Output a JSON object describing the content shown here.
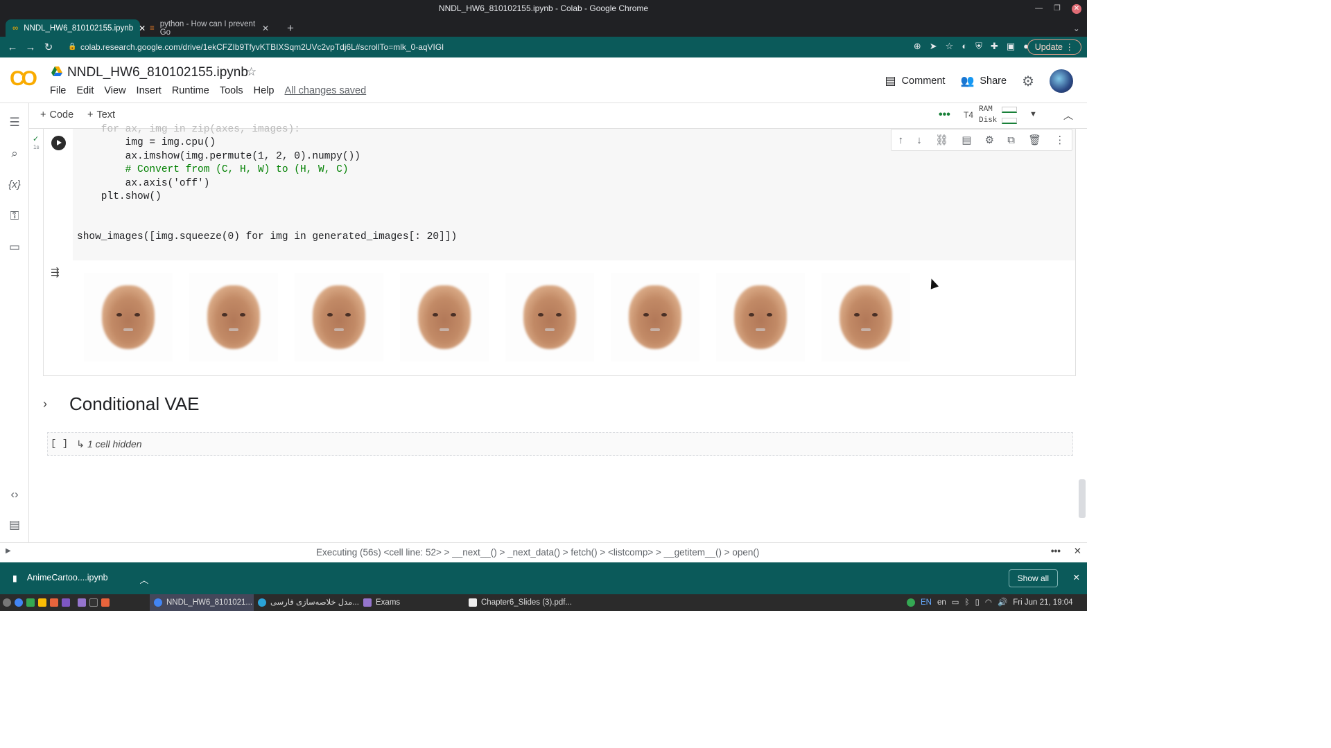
{
  "window": {
    "title": "NNDL_HW6_810102155.ipynb - Colab - Google Chrome"
  },
  "tabs": [
    {
      "label": "NNDL_HW6_810102155.ipynb"
    },
    {
      "label": "python - How can I prevent Go"
    }
  ],
  "address": {
    "url": "colab.research.google.com/drive/1ekCFZIb9TfyvKTBIXSqm2UVc2vpTdj6L#scrollTo=mlk_0-aqVIGl",
    "update_label": "Update"
  },
  "notebook": {
    "title": "NNDL_HW6_810102155.ipynb",
    "menu": [
      "File",
      "Edit",
      "View",
      "Insert",
      "Runtime",
      "Tools",
      "Help"
    ],
    "saved_status": "All changes saved",
    "comment_label": "Comment",
    "share_label": "Share"
  },
  "toolbar": {
    "code_label": "Code",
    "text_label": "Text",
    "runtime": "T4",
    "ram_label": "RAM",
    "disk_label": "Disk"
  },
  "cell": {
    "exec_time": "1s",
    "code_lines": [
      "    for ax, img in zip(axes, images):",
      "        img = img.cpu()",
      "        ax.imshow(img.permute(1, 2, 0).numpy())",
      "        # Convert from (C, H, W) to (H, W, C)",
      "        ax.axis('off')",
      "    plt.show()",
      "",
      "",
      "show_images([img.squeeze(0) for img in generated_images[: 20]])"
    ],
    "output_faces": 8
  },
  "section": {
    "title": "Conditional VAE"
  },
  "hidden_cell": {
    "brackets": "[ ]",
    "label": "1 cell hidden"
  },
  "status_bar": {
    "text": "Executing (56s)  <cell line: 52> > __next__() > _next_data() > fetch() > <listcomp> > __getitem__() > open()"
  },
  "download": {
    "file": "AnimeCartoo....ipynb",
    "show_all": "Show all"
  },
  "taskbar": {
    "items": [
      "NNDL_HW6_8101021...",
      "مدل خلاصه‌سازی فارسی...",
      "Exams",
      "Chapter6_Slides (3).pdf..."
    ],
    "lang": "EN",
    "lang2": "en",
    "clock": "Fri Jun 21, 19:04"
  }
}
